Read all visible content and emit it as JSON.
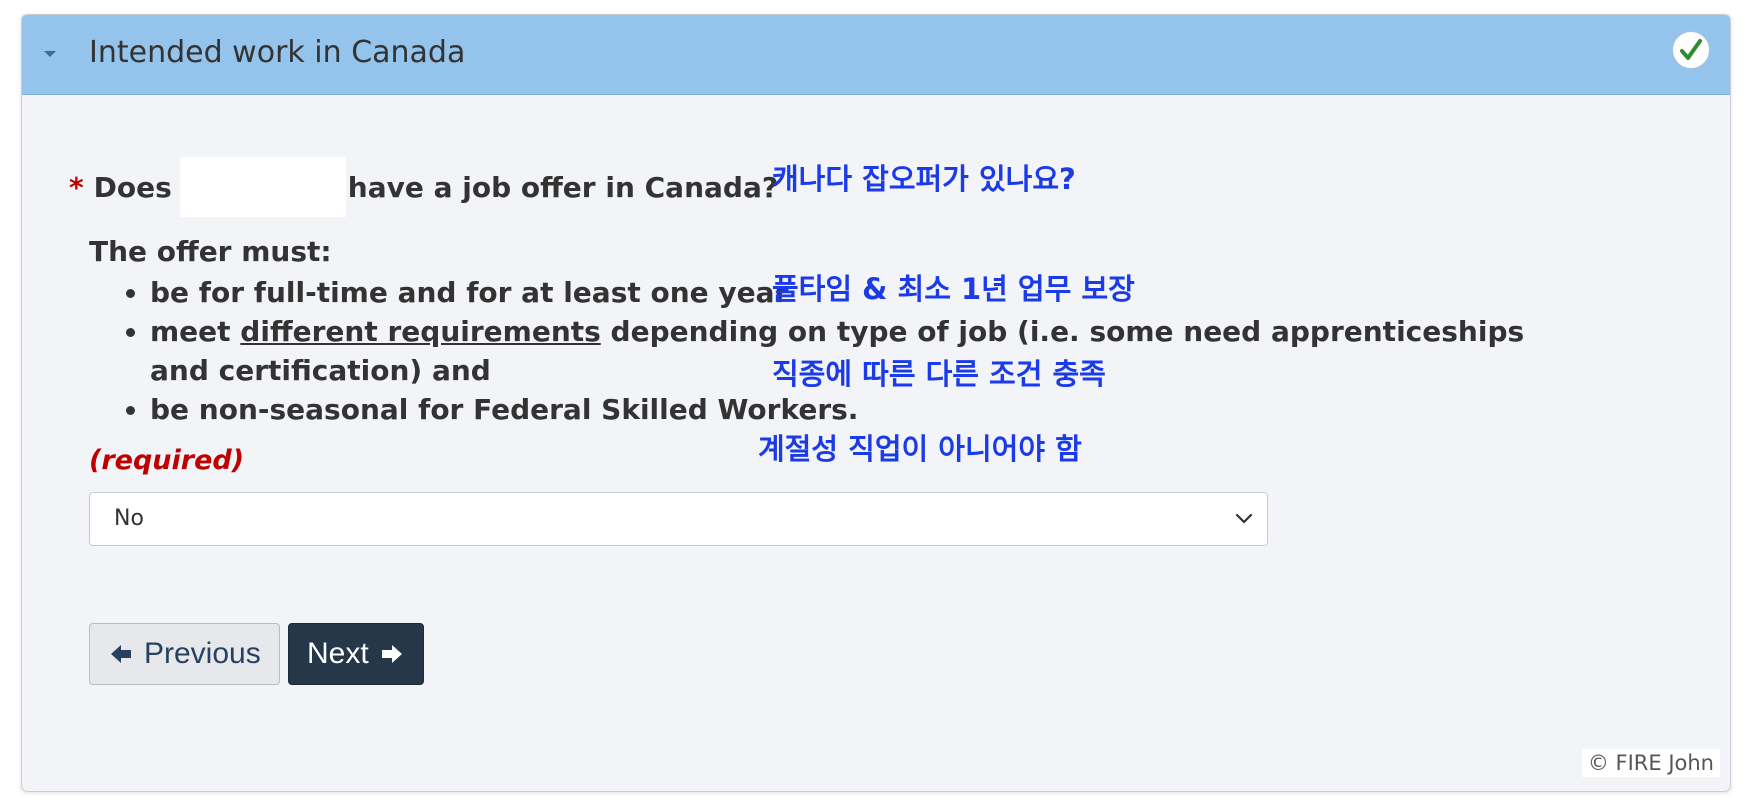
{
  "section": {
    "title": "Intended work in Canada",
    "icons": {
      "toggle": "caret-down-icon",
      "status": "checkmark-icon"
    },
    "status_color": "#2e8b2e"
  },
  "question": {
    "asterisk": "*",
    "prefix": "Does",
    "suffix": "have a job offer in Canada?",
    "annotation": "캐나다 잡오퍼가 있나요?"
  },
  "offer": {
    "heading": "The offer must:",
    "bullets": [
      {
        "text": "be for full-time and for at least one year"
      },
      {
        "before": "meet",
        "link": "different requirements",
        "after": "depending on type of job (i.e. some need apprenticeships and certification) and"
      },
      {
        "text": "be non-seasonal for Federal Skilled Workers."
      }
    ],
    "annotations": [
      "풀타임 & 최소 1년 업무 보장",
      "직종에 따른 다른 조건 충족",
      "계절성 직업이 아니어야 함"
    ]
  },
  "required_label": "(required)",
  "select": {
    "value": "No",
    "icon": "chevron-down-icon"
  },
  "buttons": {
    "previous": "Previous",
    "next": "Next",
    "previous_icon": "arrow-left-icon",
    "next_icon": "arrow-right-icon"
  },
  "watermark": "© FIRE John",
  "colors": {
    "header_bg": "#94c3eb",
    "required_red": "#c00000",
    "annotation_blue": "#1c3be8",
    "next_button_bg": "#26374a"
  }
}
